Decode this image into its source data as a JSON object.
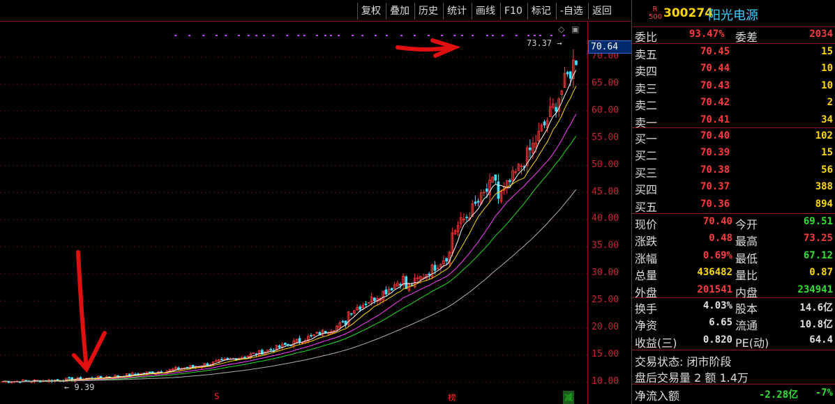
{
  "toolbar": {
    "buttons": [
      "复权",
      "叠加",
      "历史",
      "统计",
      "画线",
      "F10",
      "标记",
      "-自选",
      "返回"
    ]
  },
  "chart": {
    "current_price_tag": "70.64",
    "high_marker": "73.37",
    "low_marker": "9.39",
    "y_ticks": [
      "70.00",
      "65.00",
      "60.00",
      "55.00",
      "50.00",
      "45.00",
      "40.00",
      "35.00",
      "30.00",
      "25.00",
      "20.00",
      "15.00",
      "10.00"
    ],
    "events": [
      {
        "label": "S",
        "color": "#ff2020"
      },
      {
        "label": "榜",
        "color": "#ff2020"
      },
      {
        "label": "减",
        "color": "#20c020"
      }
    ],
    "icons": [
      "diamond-icon",
      "square-icon"
    ]
  },
  "panel": {
    "badge": [
      "R",
      "500"
    ],
    "code": "300274",
    "name": "阳光电源",
    "weibi": {
      "label": "委比",
      "value": "93.47%",
      "label2": "委差",
      "value2": "2034"
    },
    "asks": [
      {
        "label": "卖五",
        "price": "70.45",
        "vol": "15"
      },
      {
        "label": "卖四",
        "price": "70.44",
        "vol": "10"
      },
      {
        "label": "卖三",
        "price": "70.43",
        "vol": "10"
      },
      {
        "label": "卖二",
        "price": "70.42",
        "vol": "2"
      },
      {
        "label": "卖一",
        "price": "70.41",
        "vol": "34"
      }
    ],
    "bids": [
      {
        "label": "买一",
        "price": "70.40",
        "vol": "102"
      },
      {
        "label": "买二",
        "price": "70.39",
        "vol": "15"
      },
      {
        "label": "买三",
        "price": "70.38",
        "vol": "56"
      },
      {
        "label": "买四",
        "price": "70.37",
        "vol": "388"
      },
      {
        "label": "买五",
        "price": "70.36",
        "vol": "894"
      }
    ],
    "quote": [
      {
        "l1": "现价",
        "v1": "70.40",
        "l2": "今开",
        "v2": "69.51"
      },
      {
        "l1": "涨跌",
        "v1": "0.48",
        "l2": "最高",
        "v2": "73.25"
      },
      {
        "l1": "涨幅",
        "v1": "0.69%",
        "l2": "最低",
        "v2": "67.12"
      },
      {
        "l1": "总量",
        "v1": "436482",
        "l2": "量比",
        "v2": "0.87"
      },
      {
        "l1": "外盘",
        "v1": "201541",
        "l2": "内盘",
        "v2": "234941"
      }
    ],
    "fund": [
      {
        "l1": "换手",
        "v1": "4.03%",
        "l2": "股本",
        "v2": "14.6亿"
      },
      {
        "l1": "净资",
        "v1": "6.65",
        "l2": "流通",
        "v2": "10.8亿"
      },
      {
        "l1": "收益(三)",
        "v1": "0.820",
        "l2": "PE(动)",
        "v2": "64.4"
      }
    ],
    "status": "交易状态: 闭市阶段",
    "afterhours": "盘后交易量 2 额 1.4万",
    "netflow": {
      "label": "净流入额",
      "value": "-2.28亿",
      "pct": "-7%"
    }
  }
}
